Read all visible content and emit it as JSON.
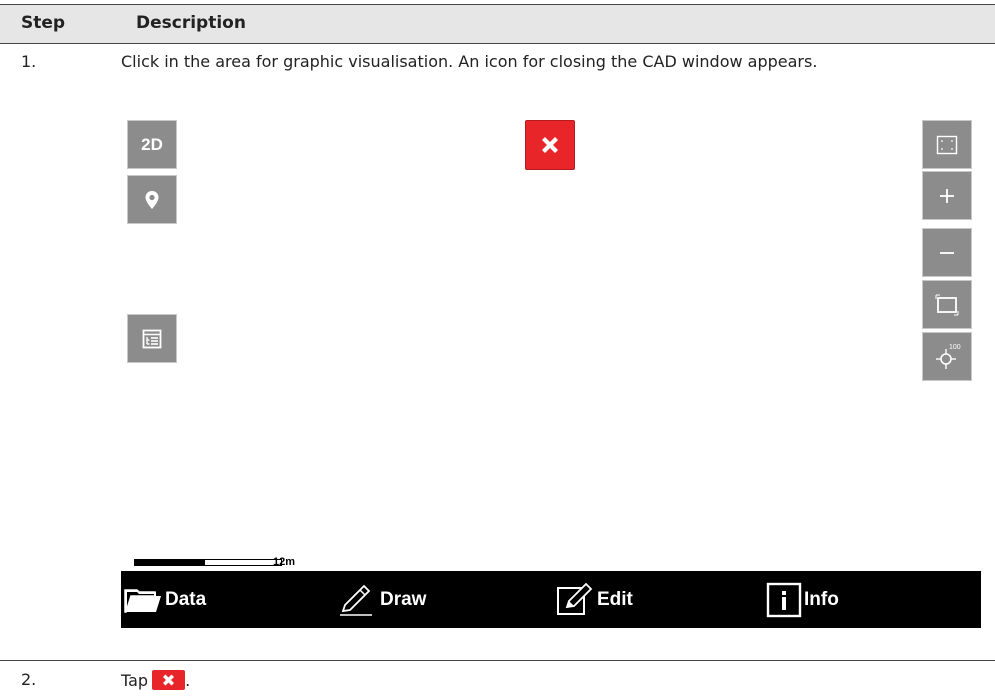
{
  "table": {
    "header": {
      "step": "Step",
      "description": "Description"
    },
    "rows": [
      {
        "step": "1.",
        "description": "Click in the area for graphic visualisation. An icon for closing the CAD window appears."
      },
      {
        "step": "2.",
        "description_prefix": "Tap",
        "description_suffix": "."
      }
    ]
  },
  "cad": {
    "left_buttons": [
      {
        "label": "2D",
        "icon": "2d-view-icon"
      },
      {
        "icon": "map-pin-icon"
      },
      {
        "icon": "layer-list-icon"
      }
    ],
    "close_button": {
      "icon": "close-x-icon",
      "color": "#e8262a"
    },
    "right_buttons": [
      {
        "icon": "fit-extent-icon"
      },
      {
        "icon": "zoom-in-icon"
      },
      {
        "icon": "zoom-out-icon"
      },
      {
        "icon": "zoom-window-icon"
      },
      {
        "icon": "zoom-target-100-icon",
        "label": "100"
      }
    ],
    "scale_bar": {
      "label": "12m"
    },
    "toolbar": [
      {
        "label": "Data",
        "icon": "folder-icon"
      },
      {
        "label": "Draw",
        "icon": "pencil-icon"
      },
      {
        "label": "Edit",
        "icon": "edit-icon"
      },
      {
        "label": "Info",
        "icon": "info-icon"
      }
    ]
  },
  "colors": {
    "button_gray": "#8c8c8c",
    "close_red": "#e8262a",
    "toolbar_bg": "#000000",
    "header_bg": "#e6e6e6"
  }
}
